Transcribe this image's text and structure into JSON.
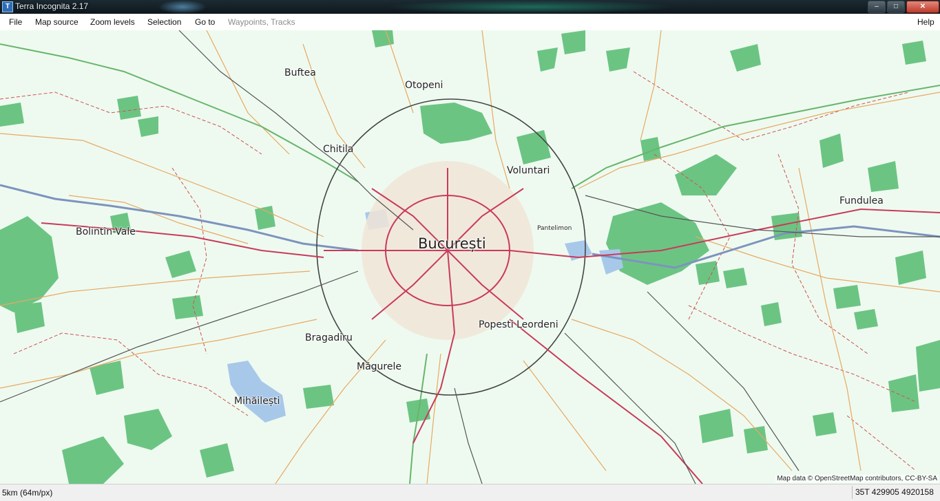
{
  "window": {
    "title": "Terra Incognita 2.17",
    "icon": "app-icon-ti"
  },
  "controls": {
    "minimize": "–",
    "maximize": "□",
    "close": "✕"
  },
  "menu": {
    "file": "File",
    "map_source": "Map source",
    "zoom_levels": "Zoom levels",
    "selection": "Selection",
    "go_to": "Go to",
    "waypoints_tracks": "Waypoints, Tracks",
    "help": "Help"
  },
  "map": {
    "cities": {
      "bucuresti": "București",
      "buftea": "Buftea",
      "otopeni": "Otopeni",
      "chitila": "Chitila",
      "voluntari": "Voluntari",
      "fundulea": "Fundulea",
      "bolintin_vale": "Bolintin-Vale",
      "pantelimon": "Pantelimon",
      "popesti_leordeni": "Popesti Leordeni",
      "bragadiru": "Bragadiru",
      "magurele": "Măgurele",
      "mihailesti": "Mihăilești"
    },
    "attribution": "Map data © OpenStreetMap contributors, CC-BY-SA",
    "colors": {
      "background": "#eefaf0",
      "forest": "#6cc483",
      "water": "#a8c8ea",
      "major_road": "#c83a5a",
      "secondary_road": "#e8a860",
      "admin_border": "#d05050",
      "river": "#7d93bd"
    }
  },
  "status": {
    "scale": "5km (64m/px)",
    "coordinates": "35T 429905 4920158"
  }
}
